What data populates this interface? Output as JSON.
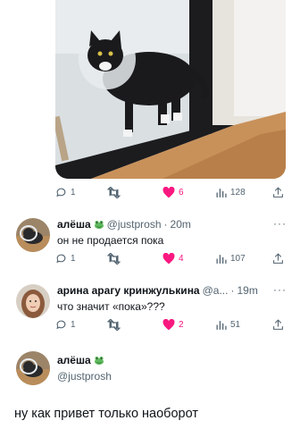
{
  "tweet_main": {
    "actions": {
      "replies": "1",
      "retweets": "",
      "likes": "6",
      "views": "128"
    }
  },
  "replies": [
    {
      "name": "алёша",
      "emoji_icon": "frog-icon",
      "handle": "@justprosh",
      "time": "20m",
      "text": "он не продается пока",
      "actions": {
        "replies": "1",
        "retweets": "",
        "likes": "4",
        "views": "107"
      }
    },
    {
      "name": "арина арагу кринжулькина",
      "handle": "@a...",
      "time": "19m",
      "text": "что значит «пока»???",
      "actions": {
        "replies": "1",
        "retweets": "",
        "likes": "2",
        "views": "51"
      }
    }
  ],
  "focused": {
    "name": "алёша",
    "emoji_icon": "frog-icon",
    "handle": "@justprosh",
    "text": "ну как привет только наоборот"
  },
  "colors": {
    "like": "#f91880",
    "muted": "#536471",
    "text": "#0f1419"
  },
  "separator": "·",
  "more_label": "···"
}
